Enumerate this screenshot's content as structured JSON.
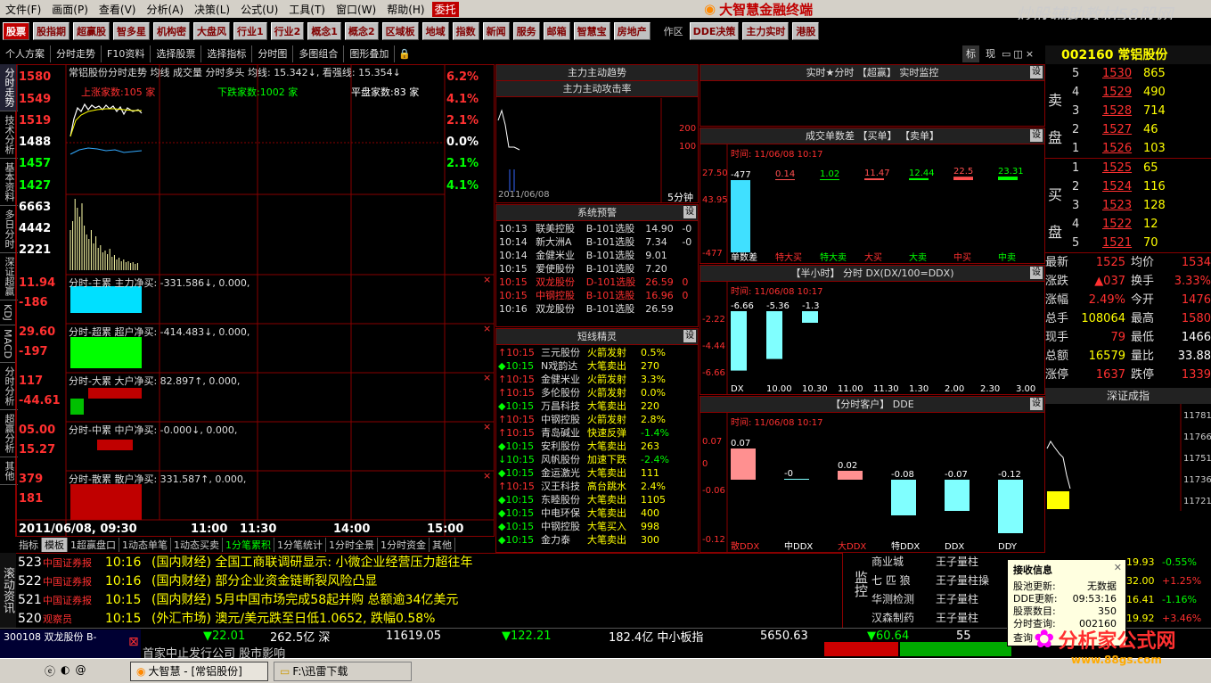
{
  "menu": [
    "文件(F)",
    "画面(P)",
    "查看(V)",
    "分析(A)",
    "决策(L)",
    "公式(U)",
    "工具(T)",
    "窗口(W)",
    "帮助(H)"
  ],
  "menu_badge": "委托",
  "app_title": "大智慧金融终端",
  "watermark": "炒股辅助教材58股网",
  "watermark_url": "www.58Gu.com",
  "toolbar": [
    "股票",
    "股指期",
    "超赢股",
    "智多星",
    "机构密",
    "大盘风",
    "行业1",
    "行业2",
    "概念1",
    "概念2",
    "区域板",
    "地域",
    "指数",
    "新闻",
    "服务",
    "邮箱",
    "智慧宝",
    "房地产"
  ],
  "toolbar_right": [
    "作区",
    "DDE决策",
    "主力实时",
    "港股"
  ],
  "subbar": [
    "个人方案",
    "分时走势",
    "F10资料",
    "选择股票",
    "选择指标",
    "分时图",
    "多图组合",
    "图形叠加"
  ],
  "vtabs": [
    "分时走势",
    "技术分析",
    "基本资料",
    "多日分时",
    "深证超赢",
    "KDJ",
    "MACD",
    "分时分析",
    "超赢分析",
    "其他"
  ],
  "chart_header": "常铝股份分时走势  均线  成交量  分时多头  均线: 15.342↓, 看强线: 15.354↓",
  "price_left": [
    "1580",
    "1549",
    "1519",
    "1488",
    "1457",
    "1427",
    "6663",
    "4442",
    "2221"
  ],
  "pct_right": [
    "6.2%",
    "4.1%",
    "2.1%",
    "0.0%",
    "2.1%",
    "4.1%"
  ],
  "updown": {
    "up": "上涨家数:105 家",
    "down": "下跌家数:1002 家",
    "flat": "平盘家数:83 家"
  },
  "subcharts": [
    {
      "y1": "11.94",
      "y2": "-186",
      "label": "分时-主累  主力净买: -331.586↓, 0.000,"
    },
    {
      "y1": "29.60",
      "y2": "-197",
      "label": "分时-超累  超户净买: -414.483↓, 0.000,"
    },
    {
      "y1": "117",
      "y2": "-44.61",
      "label": "分时-大累  大户净买: 82.897↑, 0.000,"
    },
    {
      "y1": "05.00",
      "y2": "15.27",
      "label": "分时-中累  中户净买: -0.000↓, 0.000,"
    },
    {
      "y1": "379",
      "y2": "181",
      "label": "分时-散累  散户净买: 331.587↑, 0.000,"
    }
  ],
  "time_axis": [
    "2011/06/08, 09:30",
    "11:00",
    "11:30",
    "14:00",
    "15:00"
  ],
  "bottom_tabs": [
    "指标",
    "模板",
    "1超赢盘口",
    "1动态单笔",
    "1动态买卖",
    "1分笔累积",
    "1分笔统计",
    "1分时全景",
    "1分时资金",
    "其他"
  ],
  "p_trend": {
    "title": "主力主动趋势",
    "sub": "主力主动攻击率",
    "right": "5分钟",
    "r1": "200",
    "r2": "100",
    "date": "2011/06/08"
  },
  "p_alert": {
    "title": "系统预警",
    "rows": [
      [
        "10:13",
        "联美控股",
        "B-101选股",
        "14.90",
        "-0"
      ],
      [
        "10:14",
        "新大洲A",
        "B-101选股",
        "7.34",
        "-0"
      ],
      [
        "10:14",
        "金健米业",
        "B-101选股",
        "9.01",
        ""
      ],
      [
        "10:15",
        "爱使股份",
        "B-101选股",
        "7.20",
        ""
      ],
      [
        "10:15",
        "双龙股份",
        "D-101选股",
        "26.59",
        "0"
      ],
      [
        "10:15",
        "中钢控股",
        "B-101选股",
        "16.96",
        "0"
      ],
      [
        "10:16",
        "双龙股份",
        "B-101选股",
        "26.59",
        ""
      ]
    ]
  },
  "p_elf": {
    "title": "短线精灵",
    "rows": [
      [
        "↑10:15",
        "三元股份",
        "火箭发射",
        "0.5%"
      ],
      [
        "◆10:15",
        "N戏韵达",
        "大笔卖出",
        "270"
      ],
      [
        "↑10:15",
        "金健米业",
        "火箭发射",
        "3.3%"
      ],
      [
        "↑10:15",
        "多伦股份",
        "火箭发射",
        "0.0%"
      ],
      [
        "◆10:15",
        "万昌科技",
        "大笔卖出",
        "220"
      ],
      [
        "↑10:15",
        "中钢控股",
        "火箭发射",
        "2.8%"
      ],
      [
        "↑10:15",
        "青岛碱业",
        "快速反弹",
        "-1.4%"
      ],
      [
        "◆10:15",
        "安利股份",
        "大笔卖出",
        "263"
      ],
      [
        "↓10:15",
        "风帆股份",
        "加速下跌",
        "-2.4%"
      ],
      [
        "◆10:15",
        "金运激光",
        "大笔卖出",
        "111"
      ],
      [
        "↑10:15",
        "汉王科技",
        "高台跳水",
        "2.4%"
      ],
      [
        "◆10:15",
        "东睦股份",
        "大笔卖出",
        "1105"
      ],
      [
        "◆10:15",
        "中电环保",
        "大笔卖出",
        "400"
      ],
      [
        "◆10:15",
        "中钢控股",
        "大笔买入",
        "998"
      ],
      [
        "◆10:15",
        "金力泰",
        "大笔卖出",
        "300"
      ]
    ]
  },
  "p_real": {
    "title": "实时★分时  【超赢】  实时监控"
  },
  "p_diff": {
    "title": "成交单数差  【买单】  【卖单】",
    "time": "时间: 11/06/08 10:17",
    "vals": [
      "-477",
      "0.14",
      "1.02",
      "11.47",
      "12.44",
      "22.5",
      "23.31"
    ],
    "labels": [
      "单数差",
      "特大买",
      "特大卖",
      "大买",
      "大卖",
      "中买",
      "中卖"
    ],
    "yl": [
      "27.50",
      "43.95",
      "-477"
    ]
  },
  "p_half": {
    "title": "【半小时】  分时  DX(DX/100=DDX)",
    "time": "时间: 11/06/08 10:17",
    "vals": [
      "-6.66",
      "-5.36",
      "-1.3"
    ],
    "labels": [
      "DX",
      "10.00",
      "10.30",
      "11.00",
      "11.30",
      "1.30",
      "2.00",
      "2.30",
      "3.00"
    ],
    "yl": [
      "-2.22",
      "-4.44",
      "-6.66"
    ]
  },
  "p_cust": {
    "title": "【分时客户】  DDE",
    "time": "时间: 11/06/08 10:17",
    "vals": [
      "0.07",
      "-0",
      "0.02",
      "-0.08",
      "-0.07",
      "-0.12"
    ],
    "labels": [
      "散DDX",
      "中DDX",
      "大DDX",
      "特DDX",
      "DDX",
      "DDY"
    ],
    "yl": [
      "0.07",
      "0",
      "-0.06",
      "-0.12"
    ]
  },
  "quote": {
    "code": "002160 常铝股份",
    "sell": [
      [
        "5",
        "1530",
        "865"
      ],
      [
        "4",
        "1529",
        "490"
      ],
      [
        "3",
        "1528",
        "714"
      ],
      [
        "2",
        "1527",
        "46"
      ],
      [
        "1",
        "1526",
        "103"
      ]
    ],
    "buy": [
      [
        "1",
        "1525",
        "65"
      ],
      [
        "2",
        "1524",
        "116"
      ],
      [
        "3",
        "1523",
        "128"
      ],
      [
        "4",
        "1522",
        "12"
      ],
      [
        "5",
        "1521",
        "70"
      ]
    ],
    "stats": [
      [
        "最新",
        "1525",
        "均价",
        "1534"
      ],
      [
        "涨跌",
        "▲037",
        "换手",
        "3.33%"
      ],
      [
        "涨幅",
        "2.49%",
        "今开",
        "1476"
      ],
      [
        "总手",
        "108064",
        "最高",
        "1580"
      ],
      [
        "现手",
        "79",
        "最低",
        "1466"
      ],
      [
        "总额",
        "16579",
        "量比",
        "33.88"
      ],
      [
        "涨停",
        "1637",
        "跌停",
        "1339"
      ]
    ],
    "szzs": "深证成指",
    "side_labels": [
      "卖盘",
      "买盘"
    ],
    "sz_ticks": [
      "11781",
      "11766",
      "11751",
      "11736",
      "11721"
    ]
  },
  "ticker": [
    [
      "523",
      "中国证券报",
      "10:16",
      "(国内财经) 全国工商联调研显示: 小微企业经营压力超往年"
    ],
    [
      "522",
      "中国证券报",
      "10:16",
      "(国内财经) 部分企业资金链断裂风险凸显"
    ],
    [
      "521",
      "中国证券报",
      "10:15",
      "(国内财经) 5月中国市场完成58起并购 总额逾34亿美元"
    ],
    [
      "520",
      "观察员",
      "10:15",
      "(外汇市场) 澳元/美元跌至日低1.0652, 跌幅0.58%"
    ]
  ],
  "monitor": [
    [
      "商业城",
      "王子量柱"
    ],
    [
      "七 匹 狼",
      "王子量柱操"
    ],
    [
      "华测检测",
      "王子量柱"
    ],
    [
      "汉森制药",
      "王子量柱"
    ]
  ],
  "monitor_pct": [
    [
      "19.93",
      "-0.55%"
    ],
    [
      "32.00",
      "+1.25%"
    ],
    [
      "16.41",
      "-1.16%"
    ],
    [
      "19.92",
      "+3.46%"
    ]
  ],
  "status": {
    "a": "300108 双龙股份  B-",
    "b": "22.01",
    "c": "262.5亿 深",
    "d": "11619.05",
    "e": "122.21",
    "f": "182.4亿 中小板指",
    "g": "5650.63",
    "h": "60.64",
    "i": "55"
  },
  "news_line": "首家中止发行公司 股市影响",
  "popup": {
    "title": "接收信息",
    "rows": [
      [
        "股池更新:",
        "无数据"
      ],
      [
        "DDE更新:",
        "09:53:16"
      ],
      [
        "股票数目:",
        "350"
      ],
      [
        "分时查询:",
        "002160"
      ]
    ],
    "last": "查询"
  },
  "taskbar": [
    "大智慧 - [常铝股份]",
    "F:\\迅雷下载"
  ],
  "logo": "分析家公式网",
  "logo_url": "www.88gs.com"
}
